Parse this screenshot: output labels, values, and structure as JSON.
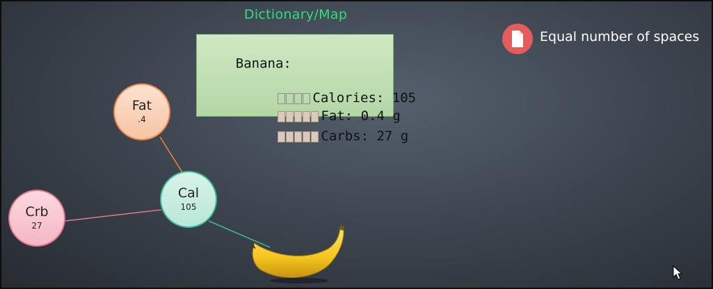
{
  "slide": {
    "title": "Dictionary/Map",
    "code": {
      "line1": "Banana:",
      "line2": "Calories: 105",
      "line3": "Fat: 0.4 g",
      "line4": "Carbs: 27 g"
    },
    "note": {
      "icon": "document-icon",
      "text": "Equal number of spaces"
    },
    "nodes": {
      "fat": {
        "label": "Fat",
        "value": ".4"
      },
      "cal": {
        "label": "Cal",
        "value": "105"
      },
      "crb": {
        "label": "Crb",
        "value": "27"
      }
    }
  },
  "colors": {
    "title": "#2fe07a",
    "code_bg": "#c2dfb4",
    "badge": "#e35d5d",
    "fat": "#f08447",
    "cal": "#3bb99b",
    "crb": "#e2788d"
  }
}
